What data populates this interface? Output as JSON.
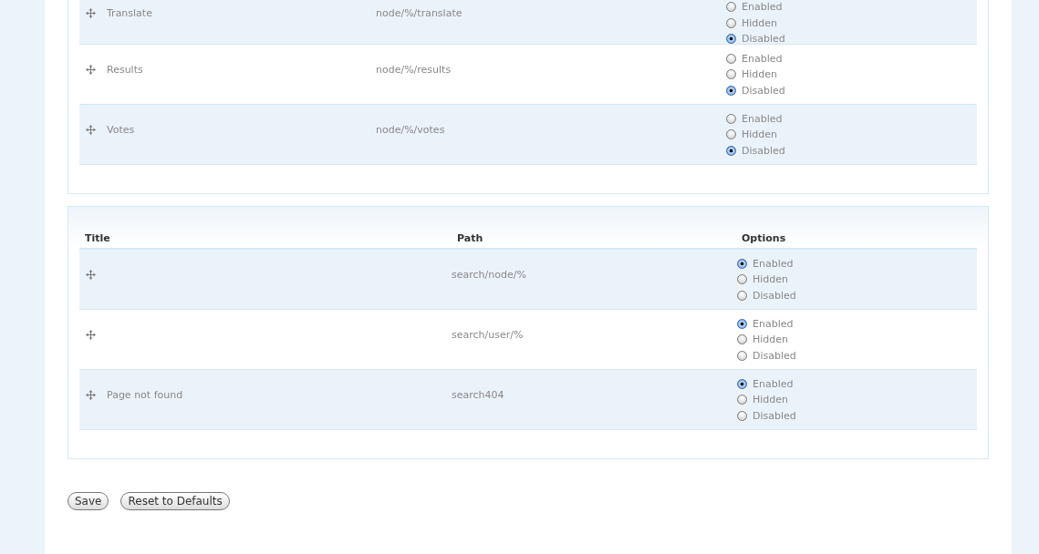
{
  "tables": [
    {
      "rows": [
        {
          "title": "Translate",
          "path": "node/%/translate",
          "options": [
            {
              "label": "Enabled",
              "selected": false
            },
            {
              "label": "Hidden",
              "selected": false
            },
            {
              "label": "Disabled",
              "selected": true
            }
          ]
        },
        {
          "title": "Results",
          "path": "node/%/results",
          "options": [
            {
              "label": "Enabled",
              "selected": false
            },
            {
              "label": "Hidden",
              "selected": false
            },
            {
              "label": "Disabled",
              "selected": true
            }
          ]
        },
        {
          "title": "Votes",
          "path": "node/%/votes",
          "options": [
            {
              "label": "Enabled",
              "selected": false
            },
            {
              "label": "Hidden",
              "selected": false
            },
            {
              "label": "Disabled",
              "selected": true
            }
          ]
        }
      ]
    },
    {
      "columns": [
        "Title",
        "Path",
        "Options"
      ],
      "rows": [
        {
          "path": "search/node/%",
          "options": [
            {
              "label": "Enabled",
              "selected": true
            },
            {
              "label": "Hidden",
              "selected": false
            },
            {
              "label": "Disabled",
              "selected": false
            }
          ]
        },
        {
          "path": "search/user/%",
          "options": [
            {
              "label": "Enabled",
              "selected": true
            },
            {
              "label": "Hidden",
              "selected": false
            },
            {
              "label": "Disabled",
              "selected": false
            }
          ]
        },
        {
          "title": "Page not found",
          "path": "search404",
          "options": [
            {
              "label": "Enabled",
              "selected": true
            },
            {
              "label": "Hidden",
              "selected": false
            },
            {
              "label": "Disabled",
              "selected": false
            }
          ]
        }
      ]
    }
  ],
  "buttons": [
    "Save",
    "Reset to Defaults"
  ]
}
